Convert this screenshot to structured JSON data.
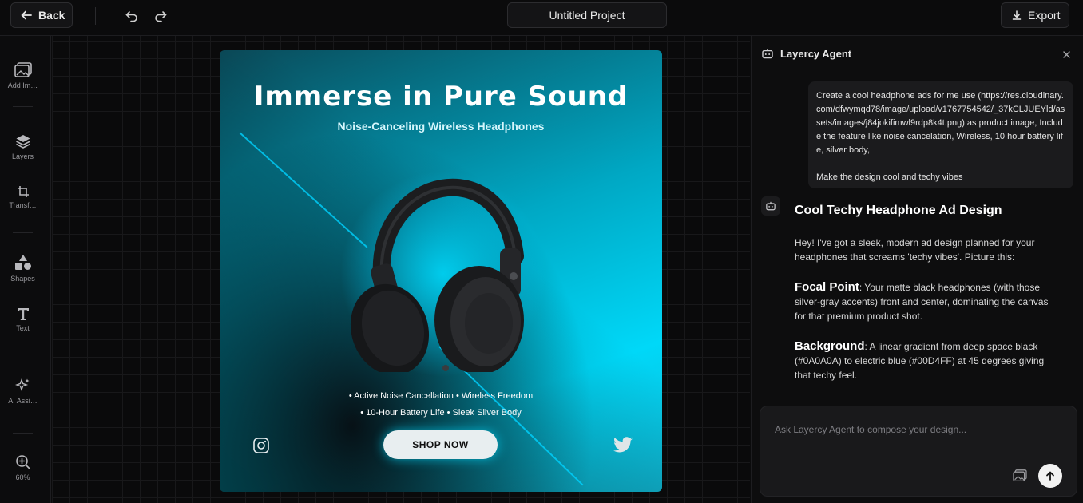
{
  "topbar": {
    "back_label": "Back",
    "project_title": "Untitled Project",
    "export_label": "Export"
  },
  "toolbar": {
    "items": [
      {
        "label": "Add Im…",
        "icon": "image-add-icon"
      },
      {
        "label": "Layers",
        "icon": "layers-icon"
      },
      {
        "label": "Transf…",
        "icon": "crop-icon"
      },
      {
        "label": "Shapes",
        "icon": "shapes-icon"
      },
      {
        "label": "Text",
        "icon": "text-icon"
      },
      {
        "label": "AI Assi…",
        "icon": "sparkles-icon"
      }
    ],
    "zoom": "60%"
  },
  "ad": {
    "title": "Immerse in Pure Sound",
    "subtitle": "Noise-Canceling Wireless Headphones",
    "features_line1": "• Active Noise Cancellation   • Wireless Freedom",
    "features_line2": "• 10-Hour Battery Life   • Sleek Silver Body",
    "cta": "SHOP NOW",
    "accent_color": "#00D4FF",
    "background_color": "#0A0A0A"
  },
  "agent_panel": {
    "title": "Layercy Agent",
    "user_message_line1": "Create a cool headphone ads for me use (https://res.cloudinary.com/dfwymqd78/image/upload/v1767754542/_37kCLJUEYld/assets/images/j84jokifimwl9rdp8k4t.png) as product image, Include the feature like noise cancelation, Wireless, 10 hour battery life, silver body,",
    "user_message_line2": "Make the design cool and techy vibes",
    "response_title": "Cool Techy Headphone Ad Design",
    "response_intro": "Hey! I've got a sleek, modern ad design planned for your headphones that screams 'techy vibes'. Picture this:",
    "focal_label": "Focal Point",
    "focal_text": ": Your matte black headphones (with those silver-gray accents) front and center, dominating the canvas for that premium product shot.",
    "background_label": "Background",
    "background_text": ": A linear gradient from deep space black (#0A0A0A) to electric blue (#00D4FF) at 45 degrees giving that techy feel.",
    "composer_placeholder": "Ask Layercy Agent to compose your design..."
  }
}
